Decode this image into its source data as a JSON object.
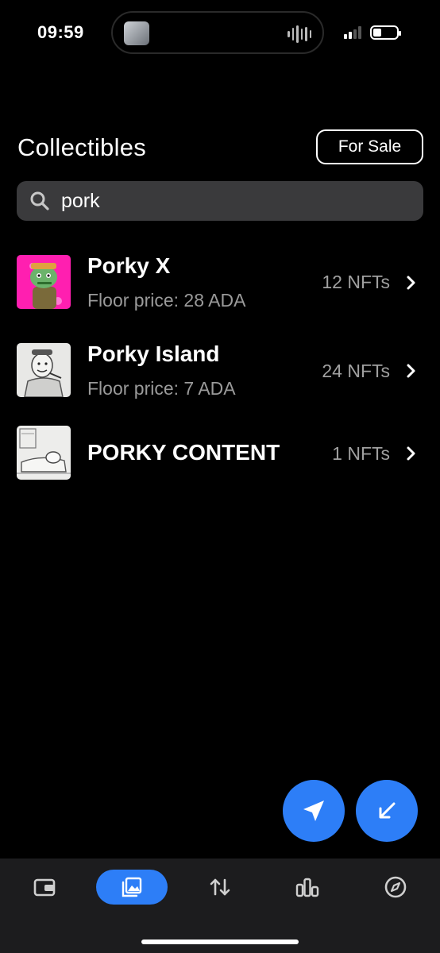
{
  "status": {
    "time": "09:59",
    "battery_level": 0.35
  },
  "header": {
    "title": "Collectibles",
    "for_sale_label": "For Sale"
  },
  "search": {
    "value": "pork"
  },
  "collections": [
    {
      "name": "Porky X",
      "floor": "Floor price: 28 ADA",
      "count": "12 NFTs"
    },
    {
      "name": "Porky Island",
      "floor": "Floor price: 7 ADA",
      "count": "24 NFTs"
    },
    {
      "name": "PORKY CONTENT",
      "floor": "",
      "count": "1 NFTs"
    }
  ],
  "actions": {
    "send_icon": "send-icon",
    "receive_icon": "receive-icon"
  },
  "tabs": [
    {
      "id": "wallet",
      "icon": "wallet-icon",
      "active": false
    },
    {
      "id": "collectibles",
      "icon": "gallery-icon",
      "active": true
    },
    {
      "id": "swap",
      "icon": "swap-icon",
      "active": false
    },
    {
      "id": "stats",
      "icon": "chart-icon",
      "active": false
    },
    {
      "id": "explore",
      "icon": "compass-icon",
      "active": false
    }
  ],
  "colors": {
    "accent": "#2d7ef7",
    "background": "#000000",
    "tabbar": "#1c1c1e",
    "search_bg": "#3a3a3c"
  }
}
